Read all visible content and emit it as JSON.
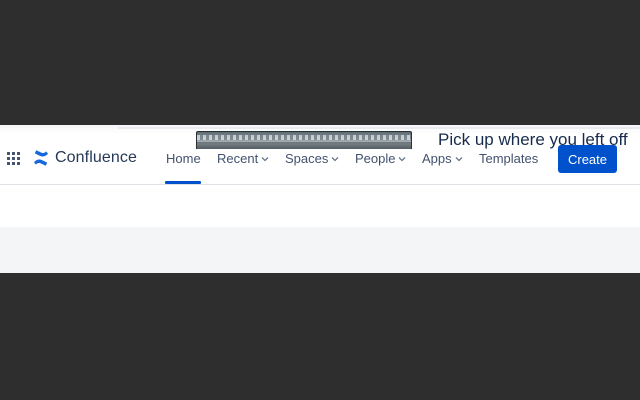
{
  "app": {
    "name": "Confluence"
  },
  "nav": {
    "items": [
      {
        "label": "Home",
        "active": true,
        "dropdown": false
      },
      {
        "label": "Recent",
        "active": false,
        "dropdown": true
      },
      {
        "label": "Spaces",
        "active": false,
        "dropdown": true
      },
      {
        "label": "People",
        "active": false,
        "dropdown": true
      },
      {
        "label": "Apps",
        "active": false,
        "dropdown": true
      },
      {
        "label": "Templates",
        "active": false,
        "dropdown": false
      }
    ],
    "create_label": "Create"
  },
  "main": {
    "heading": "Pick up where you left off"
  },
  "colors": {
    "accent": "#0052cc",
    "text": "#42526e",
    "heading": "#172b4d",
    "backdrop": "#2e2e2e"
  },
  "icons": {
    "switcher": "grid-icon",
    "logo": "confluence-logo-icon",
    "dropdown": "chevron-down-icon"
  }
}
